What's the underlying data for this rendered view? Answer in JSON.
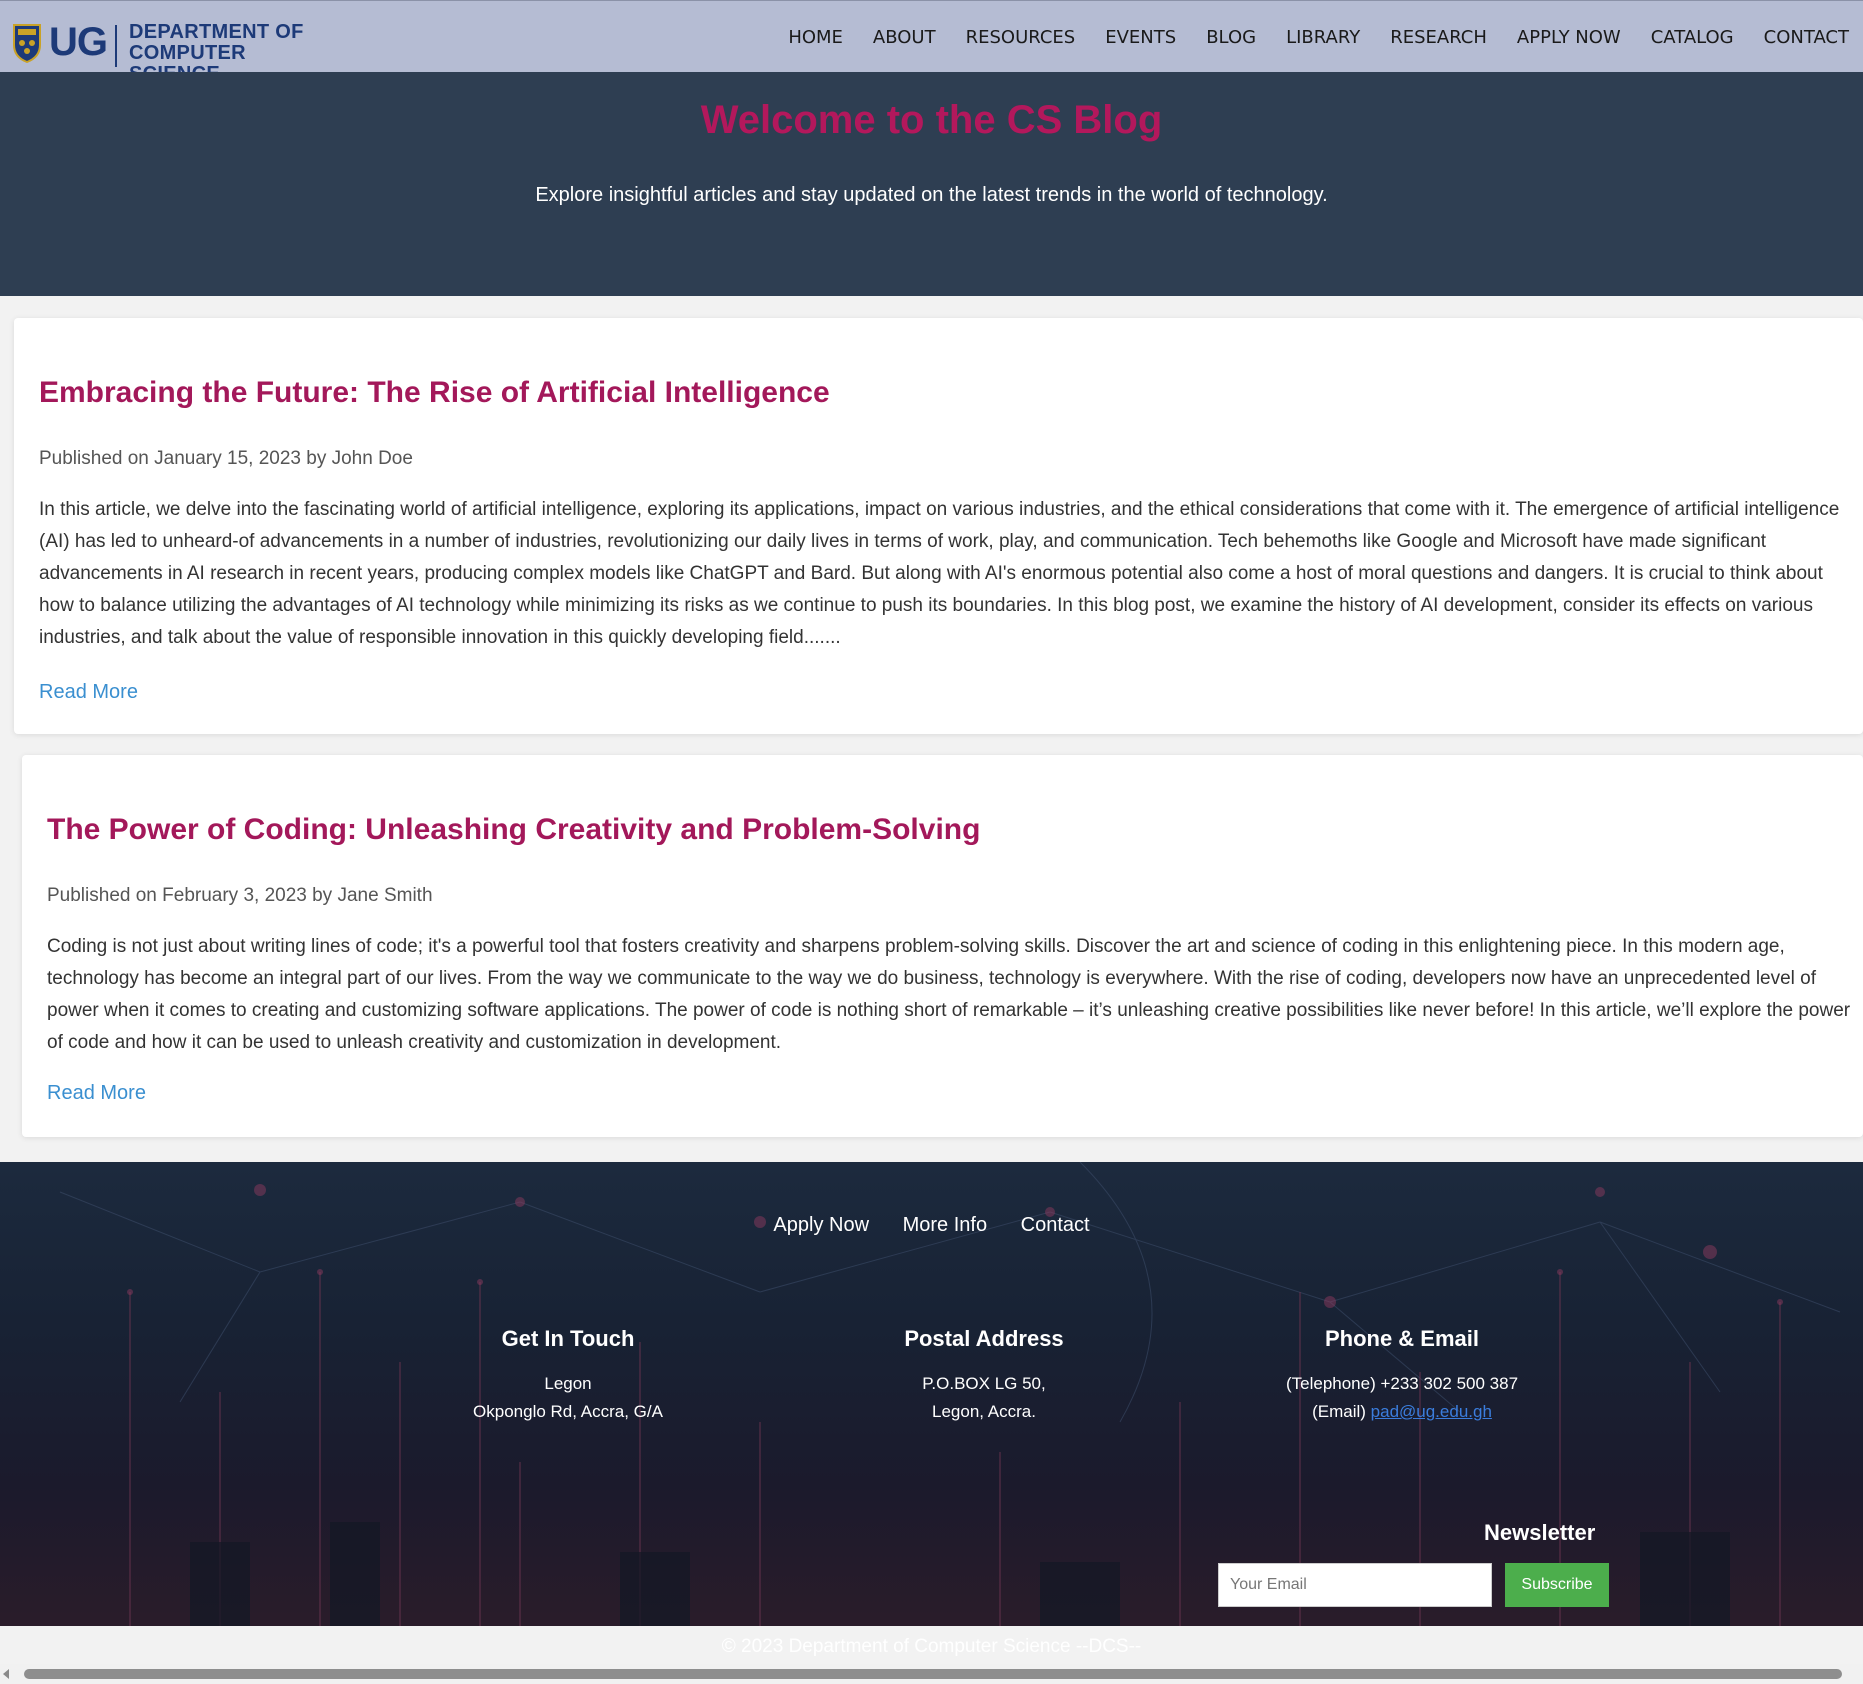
{
  "header": {
    "logo_mark": "UG",
    "logo_line1": "DEPARTMENT OF",
    "logo_line2": "COMPUTER SCIENCE",
    "nav": [
      "HOME",
      "ABOUT",
      "RESOURCES",
      "EVENTS",
      "BLOG",
      "LIBRARY",
      "RESEARCH",
      "APPLY NOW",
      "CATALOG",
      "CONTACT"
    ]
  },
  "hero": {
    "title": "Welcome to the CS Blog",
    "subtitle": "Explore insightful articles and stay updated on the latest trends in the world of technology."
  },
  "articles": [
    {
      "title": "Embracing the Future: The Rise of Artificial Intelligence",
      "meta": "Published on January 15, 2023 by John Doe",
      "excerpt": "In this article, we delve into the fascinating world of artificial intelligence, exploring its applications, impact on various industries, and the ethical considerations that come with it. The emergence of artificial intelligence (AI) has led to unheard-of advancements in a number of industries, revolutionizing our daily lives in terms of work, play, and communication. Tech behemoths like Google and Microsoft have made significant advancements in AI research in recent years, producing complex models like ChatGPT and Bard. But along with AI's enormous potential also come a host of moral questions and dangers. It is crucial to think about how to balance utilizing the advantages of AI technology while minimizing its risks as we continue to push its boundaries. In this blog post, we examine the history of AI development, consider its effects on various industries, and talk about the value of responsible innovation in this quickly developing field.......",
      "read_more": "Read More"
    },
    {
      "title": "The Power of Coding: Unleashing Creativity and Problem-Solving",
      "meta": "Published on February 3, 2023 by Jane Smith",
      "excerpt": "Coding is not just about writing lines of code; it's a powerful tool that fosters creativity and sharpens problem-solving skills. Discover the art and science of coding in this enlightening piece. In this modern age, technology has become an integral part of our lives. From the way we communicate to the way we do business, technology is everywhere. With the rise of coding, developers now have an unprecedented level of power when it comes to creating and customizing software applications. The power of code is nothing short of remarkable – it’s unleashing creative possibilities like never before! In this article, we’ll explore the power of code and how it can be used to unleash creativity and customization in development.",
      "read_more": "Read More"
    }
  ],
  "footer": {
    "links": [
      "Apply Now",
      "More Info",
      "Contact"
    ],
    "get_in_touch": {
      "title": "Get In Touch",
      "line1": "Legon",
      "line2": "Okponglo Rd, Accra, G/A"
    },
    "postal": {
      "title": "Postal Address",
      "line1": "P.O.BOX LG 50,",
      "line2": "Legon, Accra."
    },
    "phone_email": {
      "title": "Phone & Email",
      "phone": "(Telephone) +233 302 500 387",
      "email_label": "(Email)",
      "email": "pad@ug.edu.gh"
    },
    "newsletter": {
      "title": "Newsletter",
      "placeholder": "Your Email",
      "button": "Subscribe"
    },
    "copyright": "© 2023 Department of Computer Science --DCS--"
  },
  "colors": {
    "header_bg": "#b5bcd3",
    "hero_bg": "#2e3e52",
    "accent_title": "#b3185c",
    "link": "#3a8fd0",
    "subscribe": "#4cae4c"
  },
  "icons": [
    "university-crest-icon",
    "scroll-left-arrow-icon"
  ]
}
